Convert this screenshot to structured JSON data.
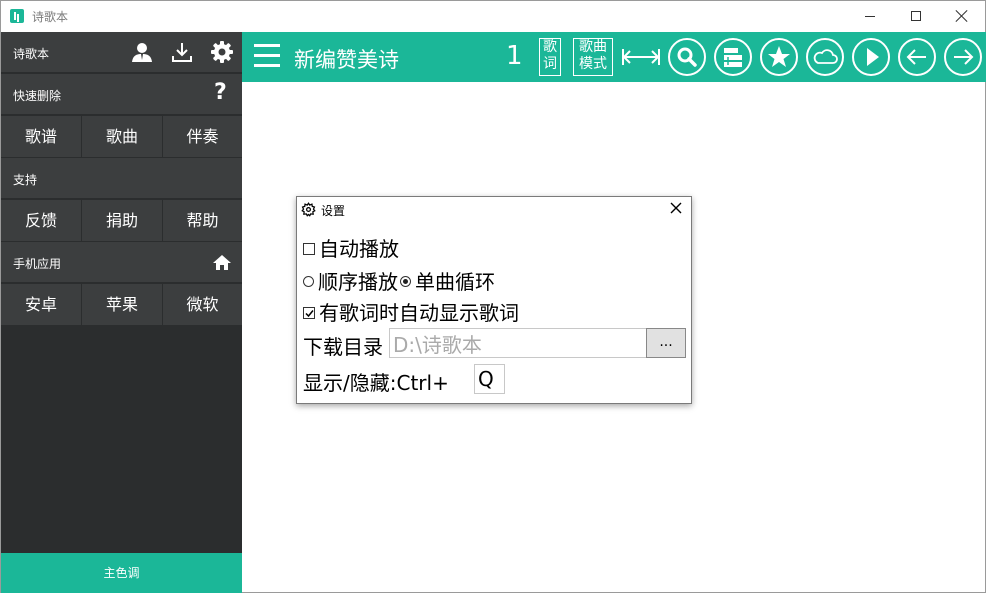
{
  "window": {
    "title": "诗歌本",
    "colors": {
      "accent": "#1bb798",
      "sidebar_bg": "#2b2d2e",
      "sidebar_item_bg": "#3c3e3f"
    }
  },
  "sidebar": {
    "header": {
      "label": "诗歌本",
      "icons": [
        "user-icon",
        "download-icon",
        "gear-icon"
      ]
    },
    "quick_delete": {
      "label": "快速删除",
      "help_symbol": "?"
    },
    "quick_delete_buttons": [
      "歌谱",
      "歌曲",
      "伴奏"
    ],
    "support": {
      "label": "支持"
    },
    "support_buttons": [
      "反馈",
      "捐助",
      "帮助"
    ],
    "mobile_apps": {
      "label": "手机应用"
    },
    "mobile_buttons": [
      "安卓",
      "苹果",
      "微软"
    ],
    "theme_button": "主色调"
  },
  "toolbar": {
    "title": "新编赞美诗",
    "number": "1",
    "lyrics_btn": {
      "line1": "歌",
      "line2": "词"
    },
    "song_mode_btn": {
      "line1": "歌曲",
      "line2": "模式"
    },
    "icons": [
      "width-arrows-icon",
      "search-icon",
      "list-icon",
      "star-icon",
      "cloud-icon",
      "play-icon",
      "arrow-left-icon",
      "arrow-right-icon"
    ]
  },
  "settings_dialog": {
    "title": "设置",
    "autoplay": {
      "label": "自动播放",
      "checked": false
    },
    "play_order": {
      "sequential": "顺序播放",
      "single_loop": "单曲循环",
      "selected": "single_loop"
    },
    "auto_lyrics": {
      "label": "有歌词时自动显示歌词",
      "checked": true
    },
    "download_dir": {
      "label": "下载目录",
      "value": "D:\\诗歌本",
      "browse": "..."
    },
    "hotkey": {
      "label": "显示/隐藏:",
      "modifier": "Ctrl+",
      "key": "Q"
    }
  }
}
